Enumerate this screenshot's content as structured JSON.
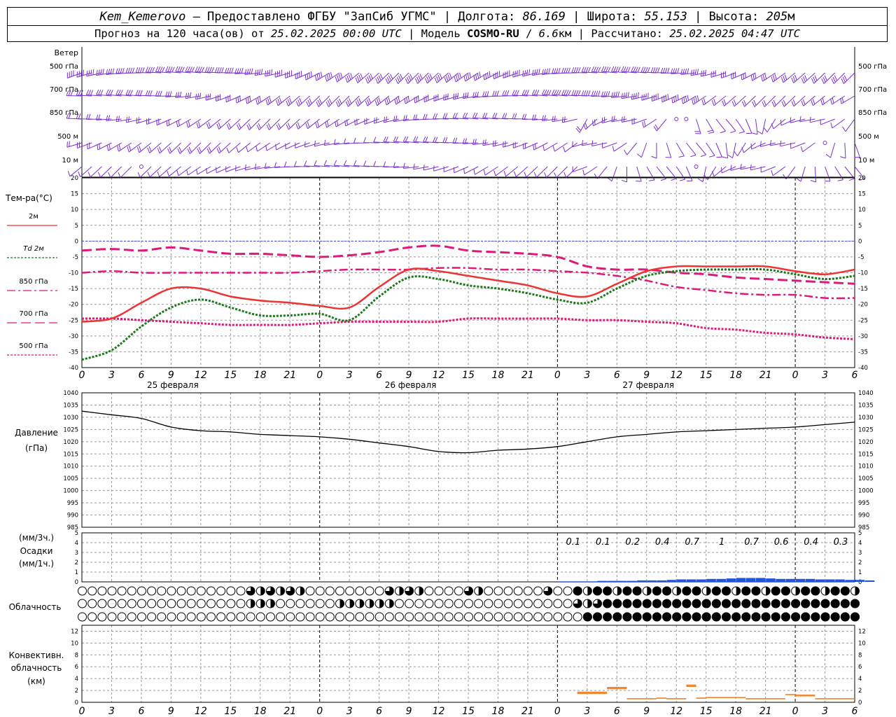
{
  "header": {
    "station": "Kem_Kemerovo",
    "provider": "– Предоставлено ФГБУ \"ЗапСиб УГМС\"",
    "lon_label": "Долгота:",
    "lon": "86.169",
    "lat_label": "Широта:",
    "lat": "55.153",
    "alt_label": "Высота:",
    "alt": "205",
    "alt_unit": "м",
    "forecast_label": "Прогноз на 120 часа(ов) от",
    "forecast_from": "25.02.2025 00:00 UTC",
    "model_label": "Модель",
    "model": "COSMO-RU",
    "model_res": "6.6",
    "model_res_unit": "км",
    "computed_label": "Рассчитано:",
    "computed": "25.02.2025 04:47 UTC"
  },
  "chart_data": [
    {
      "panel": "wind",
      "type": "wind-barbs",
      "title": "Ветер",
      "levels": [
        "500 гПа",
        "700 гПа",
        "850 гПа",
        "500 м",
        "10 м"
      ],
      "note": "Wind barbs every hour at each level; predominantly westerly/south-westerly flow"
    },
    {
      "panel": "temperature",
      "type": "line",
      "title": "Тем-ра(°C)",
      "ylim": [
        -40,
        20
      ],
      "yticks": [
        20,
        15,
        10,
        5,
        0,
        -5,
        -10,
        -15,
        -20,
        -25,
        -30,
        -35,
        -40
      ],
      "x_hours": [
        0,
        3,
        6,
        9,
        12,
        15,
        18,
        21,
        24,
        27,
        30,
        33,
        36,
        39,
        42,
        45,
        48,
        51,
        54,
        57,
        60,
        63,
        66,
        69,
        72,
        75,
        78
      ],
      "series": [
        {
          "name": "2м",
          "color": "#ee3333",
          "style": "solid",
          "values": [
            -25.5,
            -24.5,
            -19.5,
            -15,
            -15,
            -17.5,
            -18.8,
            -19.5,
            -20.5,
            -21,
            -14.5,
            -9,
            -9.5,
            -11,
            -12.5,
            -14,
            -16.5,
            -17.5,
            -13.5,
            -9.5,
            -8,
            -8,
            -8,
            -8,
            -9.5,
            -10.5,
            -9
          ]
        },
        {
          "name": "Td 2м",
          "color": "#1a7a1a",
          "style": "dotted",
          "values": [
            -37.5,
            -34.5,
            -27,
            -21,
            -18.5,
            -21,
            -23.5,
            -23.5,
            -23,
            -25,
            -17.5,
            -11.5,
            -12,
            -14,
            -15,
            -16.5,
            -18.5,
            -19.5,
            -15,
            -11,
            -9.5,
            -9,
            -9,
            -9,
            -10.5,
            -12,
            -11
          ]
        },
        {
          "name": "850 гПа",
          "color": "#dd1a7a",
          "style": "dashdot",
          "values": [
            -10,
            -9.5,
            -10,
            -10,
            -10,
            -10,
            -10,
            -10,
            -9.5,
            -9,
            -9,
            -9,
            -8.5,
            -8.5,
            -9,
            -9,
            -9.5,
            -10,
            -11,
            -12.5,
            -14.5,
            -15.5,
            -16.5,
            -17,
            -17,
            -18,
            -18
          ]
        },
        {
          "name": "700 гПа",
          "color": "#dd1a7a",
          "style": "dashed",
          "values": [
            -3,
            -2.5,
            -3,
            -2,
            -3,
            -4,
            -4,
            -4.5,
            -5,
            -4.5,
            -3.5,
            -2,
            -1.5,
            -3,
            -3.5,
            -4,
            -5,
            -8,
            -9,
            -9,
            -10,
            -10.5,
            -11.5,
            -12,
            -12.5,
            -13,
            -13.5
          ]
        },
        {
          "name": "500 гПа",
          "color": "#dd1a7a",
          "style": "fine-dashed",
          "values": [
            -24.5,
            -24.5,
            -25,
            -25.5,
            -26,
            -26.5,
            -26.5,
            -26.5,
            -26,
            -25.5,
            -25.5,
            -25.5,
            -25.5,
            -24.5,
            -24.5,
            -24.5,
            -24.5,
            -25,
            -25,
            -25.5,
            -26,
            -27.5,
            -28,
            -29,
            -29.5,
            -30.5,
            -31
          ]
        }
      ],
      "day_labels": [
        "25 февраля",
        "26 февраля",
        "27 февраля"
      ]
    },
    {
      "panel": "pressure",
      "type": "line",
      "title": "Давление",
      "unit": "(гПа)",
      "ylim": [
        985,
        1040
      ],
      "yticks": [
        1040,
        1035,
        1030,
        1025,
        1020,
        1015,
        1010,
        1005,
        1000,
        995,
        990,
        985
      ],
      "x_hours": [
        0,
        3,
        6,
        9,
        12,
        15,
        18,
        21,
        24,
        27,
        30,
        33,
        36,
        39,
        42,
        45,
        48,
        51,
        54,
        57,
        60,
        63,
        66,
        69,
        72,
        75,
        78
      ],
      "values": [
        1032.5,
        1031,
        1029.5,
        1026,
        1024.5,
        1024,
        1023,
        1022.5,
        1022,
        1021,
        1019.5,
        1018,
        1016,
        1015.5,
        1016.5,
        1017,
        1018,
        1020,
        1022,
        1023,
        1024,
        1024.5,
        1025,
        1025.5,
        1026,
        1027,
        1028
      ]
    },
    {
      "panel": "precipitation",
      "type": "bar",
      "title": "Осадки",
      "unit_top": "(мм/3ч.)",
      "unit_bottom": "(мм/1ч.)",
      "ylim": [
        0,
        5
      ],
      "yticks": [
        5,
        4,
        3,
        2,
        1,
        0
      ],
      "labels_3h": [
        {
          "hour": 51,
          "value": "0.1"
        },
        {
          "hour": 54,
          "value": "0.1"
        },
        {
          "hour": 57,
          "value": "0.2"
        },
        {
          "hour": 60,
          "value": "0.4"
        },
        {
          "hour": 63,
          "value": "0.7"
        },
        {
          "hour": 66,
          "value": "1"
        },
        {
          "hour": 69,
          "value": "0.7"
        },
        {
          "hour": 72,
          "value": "0.6"
        },
        {
          "hour": 75,
          "value": "0.4"
        },
        {
          "hour": 78,
          "value": "0.3"
        }
      ],
      "hourly_start": 49,
      "hourly": [
        0.05,
        0.05,
        0.05,
        0.05,
        0.1,
        0.1,
        0.1,
        0.1,
        0.15,
        0.15,
        0.15,
        0.2,
        0.25,
        0.25,
        0.25,
        0.3,
        0.3,
        0.35,
        0.4,
        0.4,
        0.4,
        0.35,
        0.3,
        0.3,
        0.3,
        0.3,
        0.25,
        0.25,
        0.25,
        0.2,
        0.2,
        0.15
      ]
    },
    {
      "panel": "cloudiness",
      "type": "table",
      "title": "Облачность",
      "rows": [
        "upper",
        "middle",
        "lower"
      ]
    },
    {
      "panel": "convective",
      "type": "bar",
      "title": "Конвективн.",
      "title2": "облачность",
      "unit": "(км)",
      "ylim": [
        0,
        13
      ],
      "yticks": [
        12,
        10,
        8,
        6,
        4,
        2,
        0
      ],
      "segments": [
        {
          "from": 50,
          "to": 53,
          "bottom": 1.4,
          "top": 1.8
        },
        {
          "from": 53,
          "to": 55,
          "bottom": 2.2,
          "top": 2.6
        },
        {
          "from": 55,
          "to": 58,
          "bottom": 0.5,
          "top": 0.7
        },
        {
          "from": 58,
          "to": 59,
          "bottom": 0.6,
          "top": 0.8
        },
        {
          "from": 59,
          "to": 61,
          "bottom": 0.5,
          "top": 0.7
        },
        {
          "from": 61,
          "to": 62,
          "bottom": 2.6,
          "top": 3.0
        },
        {
          "from": 62,
          "to": 63,
          "bottom": 0.6,
          "top": 0.8
        },
        {
          "from": 63,
          "to": 67,
          "bottom": 0.7,
          "top": 0.9
        },
        {
          "from": 67,
          "to": 71,
          "bottom": 0.5,
          "top": 0.7
        },
        {
          "from": 71,
          "to": 72,
          "bottom": 1.2,
          "top": 1.4
        },
        {
          "from": 72,
          "to": 74,
          "bottom": 1.0,
          "top": 1.3
        },
        {
          "from": 74,
          "to": 78,
          "bottom": 0.5,
          "top": 0.7
        }
      ]
    }
  ],
  "x_axis": {
    "hour_labels": [
      "0",
      "3",
      "6",
      "9",
      "12",
      "15",
      "18",
      "21",
      "0",
      "3",
      "6",
      "9",
      "12",
      "15",
      "18",
      "21",
      "0",
      "3",
      "6",
      "9",
      "12",
      "15",
      "18",
      "21",
      "0",
      "3",
      "6"
    ]
  }
}
